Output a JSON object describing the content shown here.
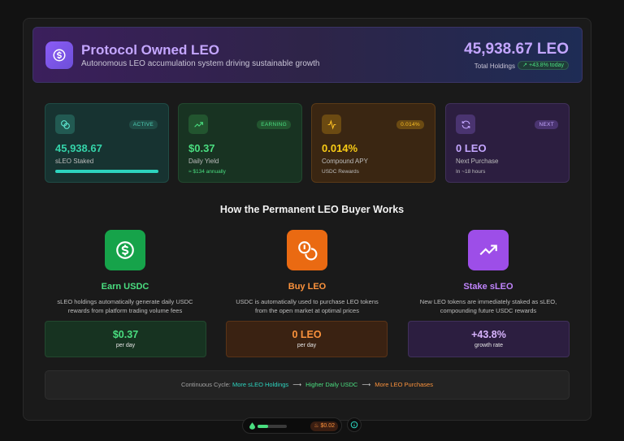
{
  "header": {
    "title": "Protocol Owned LEO",
    "subtitle": "Autonomous LEO accumulation system driving sustainable growth",
    "total_value": "45,938.67 LEO",
    "total_label": "Total Holdings",
    "growth_badge": "↗ +43.8% today"
  },
  "stats": [
    {
      "tag": "ACTIVE",
      "value": "45,938.67",
      "label": "sLEO Staked",
      "icon": "coins-icon",
      "progress": 1.0
    },
    {
      "tag": "EARNING",
      "value": "$0.37",
      "label": "Daily Yield",
      "sub": "≈ $134 annually",
      "icon": "trending-up-icon"
    },
    {
      "tag": "0.014%",
      "value": "0.014%",
      "label": "Compound APY",
      "sub": "USDC Rewards",
      "icon": "activity-icon"
    },
    {
      "tag": "NEXT",
      "value": "0 LEO",
      "label": "Next Purchase",
      "sub": "In ~18 hours",
      "icon": "refresh-icon"
    }
  ],
  "how_it_works": {
    "title": "How the Permanent LEO Buyer Works",
    "steps": [
      {
        "name": "Earn USDC",
        "desc": "sLEO holdings automatically generate daily USDC rewards from platform trading volume fees",
        "value": "$0.37",
        "unit": "per day",
        "icon": "dollar-circle-icon",
        "color": "#16a34a"
      },
      {
        "name": "Buy LEO",
        "desc": "USDC is automatically used to purchase LEO tokens from the open market at optimal prices",
        "value": "0 LEO",
        "unit": "per day",
        "icon": "coins-icon",
        "color": "#ea6a12"
      },
      {
        "name": "Stake sLEO",
        "desc": "New LEO tokens are immediately staked as sLEO, compounding future USDC rewards",
        "value": "+43.8%",
        "unit": "growth rate",
        "icon": "trending-up-icon",
        "color": "#9d4ee8"
      }
    ]
  },
  "cycle": {
    "label": "Continuous Cycle:",
    "step1": "More sLEO Holdings",
    "step2": "Higher Daily USDC",
    "step3": "More LEO Purchases",
    "arrow": "⟶"
  },
  "dock": {
    "progress": 0.35,
    "price": "$0.02"
  }
}
